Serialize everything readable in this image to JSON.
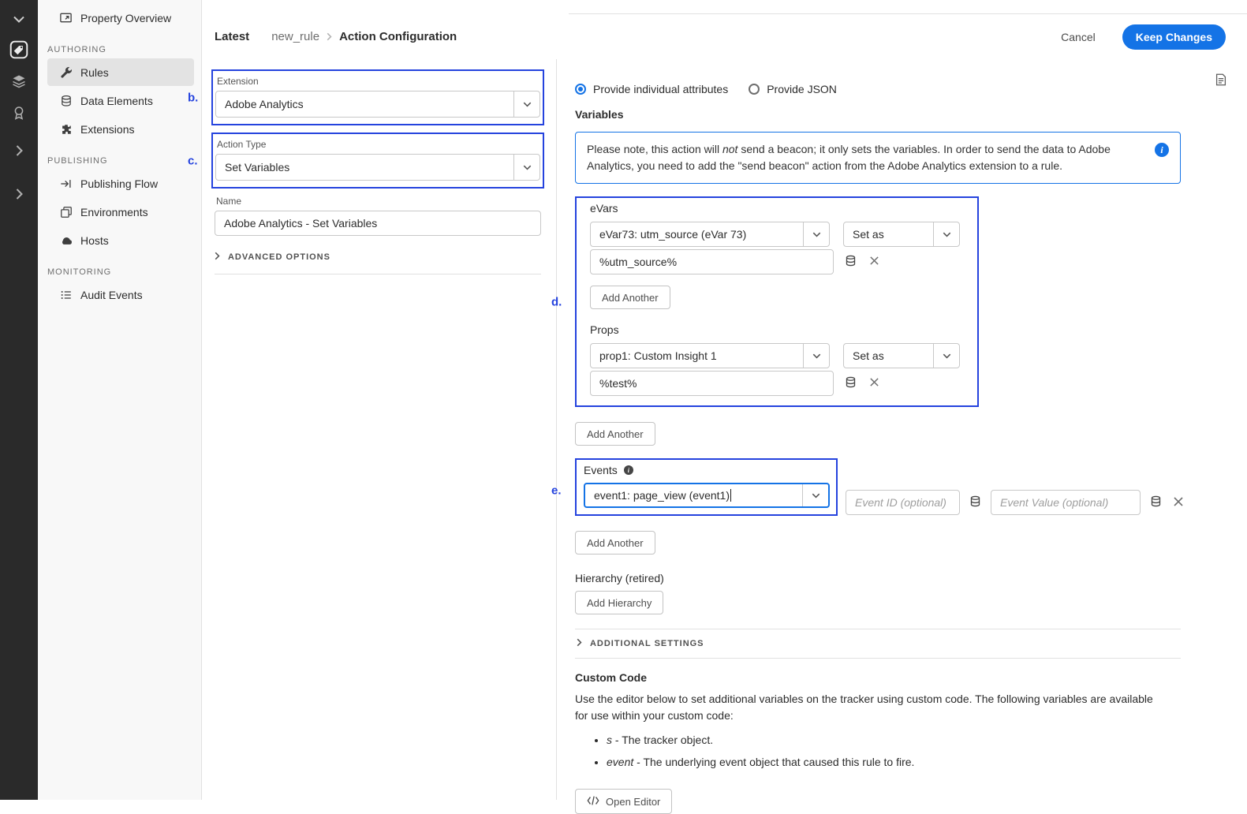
{
  "colors": {
    "accent": "#1473e6",
    "annotation": "#2543de",
    "rail-bg": "#2a2a2a",
    "sidebar-bg": "#f8f8f8",
    "selected-item-bg": "#e3e3e3",
    "border": "#e1e1e1",
    "field-border": "#c8c8c8",
    "text": "#2c2c2c",
    "muted": "#6e6e6e"
  },
  "icons": {
    "chevron_down": "v-chevron",
    "chevron_right": ">-chevron",
    "remove": "✕",
    "data_element": "database-cylinder",
    "info": "i",
    "code": "</>"
  },
  "sidebar": {
    "top_item": {
      "label": "Property Overview",
      "icon": "property-overview-icon"
    },
    "sections": [
      {
        "label": "AUTHORING",
        "items": [
          {
            "label": "Rules",
            "icon": "wrench-icon",
            "selected": true
          },
          {
            "label": "Data Elements",
            "icon": "database-icon"
          },
          {
            "label": "Extensions",
            "icon": "puzzle-icon"
          }
        ]
      },
      {
        "label": "PUBLISHING",
        "items": [
          {
            "label": "Publishing Flow",
            "icon": "flow-arrow-icon"
          },
          {
            "label": "Environments",
            "icon": "stacked-windows-icon"
          },
          {
            "label": "Hosts",
            "icon": "cloud-icon"
          }
        ]
      },
      {
        "label": "MONITORING",
        "items": [
          {
            "label": "Audit Events",
            "icon": "audit-list-icon"
          }
        ]
      }
    ]
  },
  "header": {
    "breadcrumb": {
      "latest": "Latest",
      "rule": "new_rule",
      "page": "Action Configuration"
    },
    "cancel": "Cancel",
    "keep_changes": "Keep Changes"
  },
  "form": {
    "extension": {
      "label": "Extension",
      "value": "Adobe Analytics"
    },
    "action_type": {
      "label": "Action Type",
      "value": "Set Variables"
    },
    "name": {
      "label": "Name",
      "value": "Adobe Analytics - Set Variables"
    },
    "advanced_options": "ADVANCED OPTIONS"
  },
  "editor": {
    "radios": {
      "individual": "Provide individual attributes",
      "json": "Provide JSON",
      "selected": "individual"
    },
    "variables_title": "Variables",
    "notice": {
      "p1": "Please note, this action will ",
      "em": "not",
      "p2": " send a beacon; it only sets the variables. In order to send the data to Adobe Analytics, you need to add the \"send beacon\" action from the Adobe Analytics extension to a rule."
    },
    "labels": {
      "add_another": "Add Another"
    },
    "evars": {
      "title": "eVars",
      "variable": "eVar73: utm_source (eVar 73)",
      "mode": "Set as",
      "value": "%utm_source%"
    },
    "props": {
      "title": "Props",
      "variable": "prop1: Custom Insight 1",
      "mode": "Set as",
      "value": "%test%"
    },
    "events": {
      "title": "Events",
      "variable": "event1: page_view (event1)",
      "id_placeholder": "Event ID (optional)",
      "value_placeholder": "Event Value (optional)"
    },
    "hierarchy": {
      "title": "Hierarchy (retired)",
      "button": "Add Hierarchy"
    },
    "additional_settings": "ADDITIONAL SETTINGS",
    "custom_code": {
      "title": "Custom Code",
      "body": "Use the editor below to set additional variables on the tracker using custom code. The following variables are available for use within your custom code:",
      "bullets": [
        {
          "term": "s",
          "rest": " - The tracker object."
        },
        {
          "term": "event",
          "rest": " - The underlying event object that caused this rule to fire."
        }
      ],
      "open_editor": "Open Editor"
    }
  },
  "annotations": {
    "b": "b.",
    "c": "c.",
    "d": "d.",
    "e": "e."
  }
}
